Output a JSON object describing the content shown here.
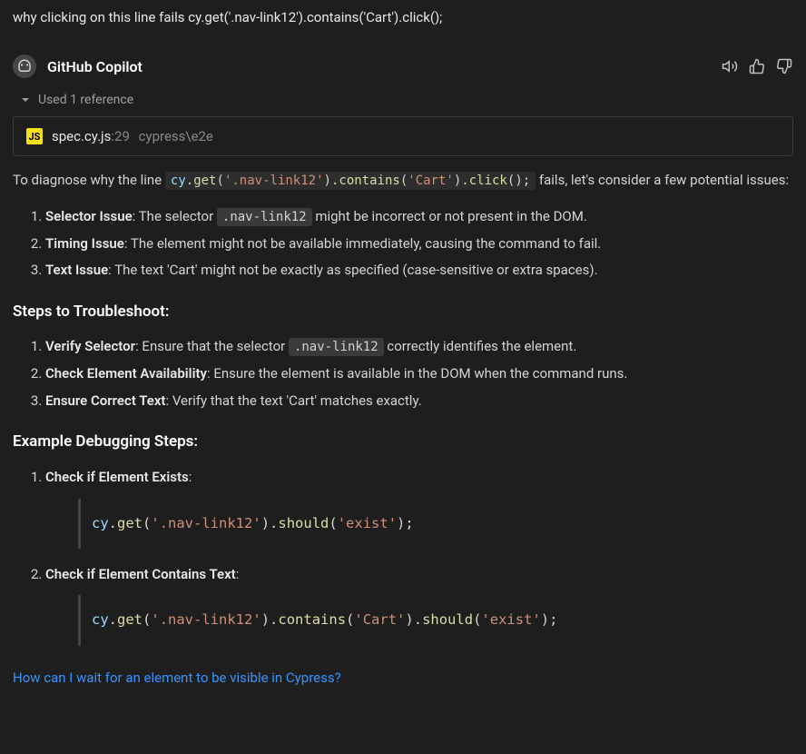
{
  "user_query": "why clicking on this line fails cy.get('.nav-link12').contains('Cart').click();",
  "assistant": {
    "name": "GitHub Copilot",
    "references_label": "Used 1 reference",
    "reference": {
      "js_badge": "JS",
      "filename": "spec.cy.js",
      "line": ":29",
      "path": "cypress\\e2e"
    }
  },
  "response": {
    "intro_prefix": "To diagnose why the line ",
    "intro_code": "cy.get('.nav-link12').contains('Cart').click();",
    "intro_suffix": " fails, let's consider a few potential issues:",
    "issues": [
      {
        "bold": "Selector Issue",
        "rest_a": ": The selector ",
        "code": ".nav-link12",
        "rest_b": " might be incorrect or not present in the DOM."
      },
      {
        "bold": "Timing Issue",
        "rest_a": ": The element might not be available immediately, causing the command to fail.",
        "code": "",
        "rest_b": ""
      },
      {
        "bold": "Text Issue",
        "rest_a": ": The text 'Cart' might not be exactly as specified (case-sensitive or extra spaces).",
        "code": "",
        "rest_b": ""
      }
    ],
    "steps_heading": "Steps to Troubleshoot:",
    "steps": [
      {
        "bold": "Verify Selector",
        "rest_a": ": Ensure that the selector ",
        "code": ".nav-link12",
        "rest_b": " correctly identifies the element."
      },
      {
        "bold": "Check Element Availability",
        "rest_a": ": Ensure the element is available in the DOM when the command runs.",
        "code": "",
        "rest_b": ""
      },
      {
        "bold": "Ensure Correct Text",
        "rest_a": ": Verify that the text 'Cart' matches exactly.",
        "code": "",
        "rest_b": ""
      }
    ],
    "example_heading": "Example Debugging Steps:",
    "debug": [
      {
        "label": "Check if Element Exists",
        "suffix": ":",
        "code": "cy.get('.nav-link12').should('exist');"
      },
      {
        "label": "Check if Element Contains Text",
        "suffix": ":",
        "code": "cy.get('.nav-link12').contains('Cart').should('exist');"
      }
    ]
  },
  "suggestion": "How can I wait for an element to be visible in Cypress?"
}
